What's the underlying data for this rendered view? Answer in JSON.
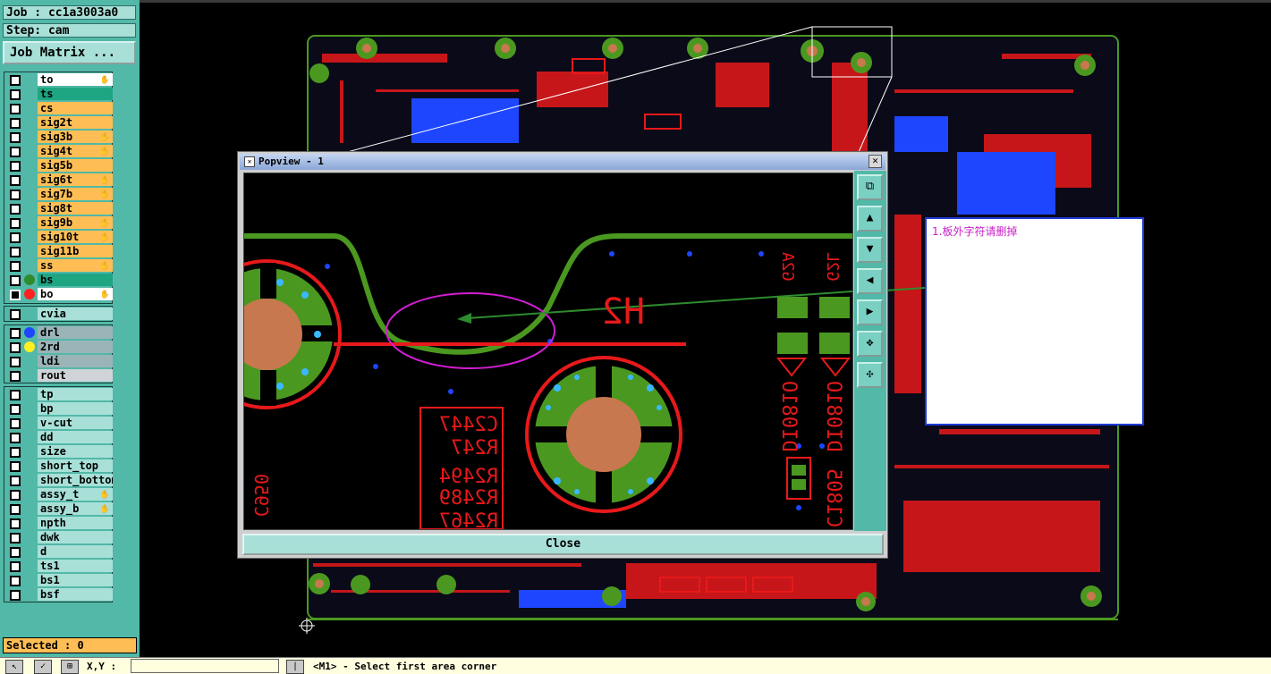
{
  "job": {
    "label": "Job : cc1a3003a0",
    "step": "Step: cam",
    "matrix_button": "Job Matrix ..."
  },
  "layers_main": [
    {
      "name": "to",
      "color": "wht",
      "checked": false,
      "hand": true
    },
    {
      "name": "ts",
      "color": "grn",
      "checked": false,
      "hand": false
    },
    {
      "name": "cs",
      "color": "yel",
      "checked": false,
      "hand": false
    },
    {
      "name": "sig2t",
      "color": "yel",
      "checked": false,
      "hand": false
    },
    {
      "name": "sig3b",
      "color": "yel",
      "checked": false,
      "hand": true
    },
    {
      "name": "sig4t",
      "color": "yel",
      "checked": false,
      "hand": true
    },
    {
      "name": "sig5b",
      "color": "yel",
      "checked": false,
      "hand": false
    },
    {
      "name": "sig6t",
      "color": "yel",
      "checked": false,
      "hand": true
    },
    {
      "name": "sig7b",
      "color": "yel",
      "checked": false,
      "hand": true
    },
    {
      "name": "sig8t",
      "color": "yel",
      "checked": false,
      "hand": false
    },
    {
      "name": "sig9b",
      "color": "yel",
      "checked": false,
      "hand": true
    },
    {
      "name": "sig10t",
      "color": "yel",
      "checked": false,
      "hand": true
    },
    {
      "name": "sig11b",
      "color": "yel",
      "checked": false,
      "hand": false
    },
    {
      "name": "ss",
      "color": "yel",
      "checked": false,
      "hand": true
    },
    {
      "name": "bs",
      "color": "grn",
      "checked": false,
      "hand": false,
      "dot": "#2e8b2e"
    },
    {
      "name": "bo",
      "color": "wht",
      "checked": true,
      "hand": true,
      "dot": "#ff2020"
    }
  ],
  "layers_via": [
    {
      "name": "cvia",
      "color": "lb",
      "checked": false
    }
  ],
  "layers_drill": [
    {
      "name": "drl",
      "color": "gry",
      "checked": false,
      "dot": "#1e46ff"
    },
    {
      "name": "2rd",
      "color": "gry",
      "checked": false,
      "dot": "#ffee20"
    },
    {
      "name": "ldi",
      "color": "gry",
      "checked": false
    },
    {
      "name": "rout",
      "color": "lg",
      "checked": false
    }
  ],
  "layers_misc": [
    {
      "name": "tp",
      "hand": false
    },
    {
      "name": "bp",
      "hand": false
    },
    {
      "name": "v-cut",
      "hand": false
    },
    {
      "name": "dd",
      "hand": false
    },
    {
      "name": "size",
      "hand": false
    },
    {
      "name": "short_top",
      "hand": false
    },
    {
      "name": "short_bottom",
      "hand": false
    },
    {
      "name": "assy_t",
      "hand": true
    },
    {
      "name": "assy_b",
      "hand": true
    },
    {
      "name": "npth",
      "hand": false
    },
    {
      "name": "dwk",
      "hand": false
    },
    {
      "name": "d",
      "hand": false
    },
    {
      "name": "ts1",
      "hand": false
    },
    {
      "name": "bs1",
      "hand": false
    },
    {
      "name": "bsf",
      "hand": false
    }
  ],
  "selected": "Selected : 0",
  "status": {
    "xy_label": "X,Y :",
    "xy_value": "",
    "prompt": "<M1> - Select first area corner"
  },
  "popview": {
    "title": "Popview - 1",
    "close_label": "Close",
    "silk_labels": {
      "h2": "H2",
      "d1": "DI081O",
      "d2": "DI081O",
      "r1": "C2447",
      "r2": "R247",
      "r3": "R2494",
      "r4": "R2489",
      "r5": "R2467",
      "c1": "C950",
      "c2": "C1805",
      "g1": "G2A",
      "g2": "G2L"
    }
  },
  "note": {
    "text": "1.板外字符请删掉"
  },
  "colors": {
    "panel": "#52b8a8",
    "copper": "#e8191a",
    "green": "#4b9820",
    "pad": "#c8784e"
  }
}
